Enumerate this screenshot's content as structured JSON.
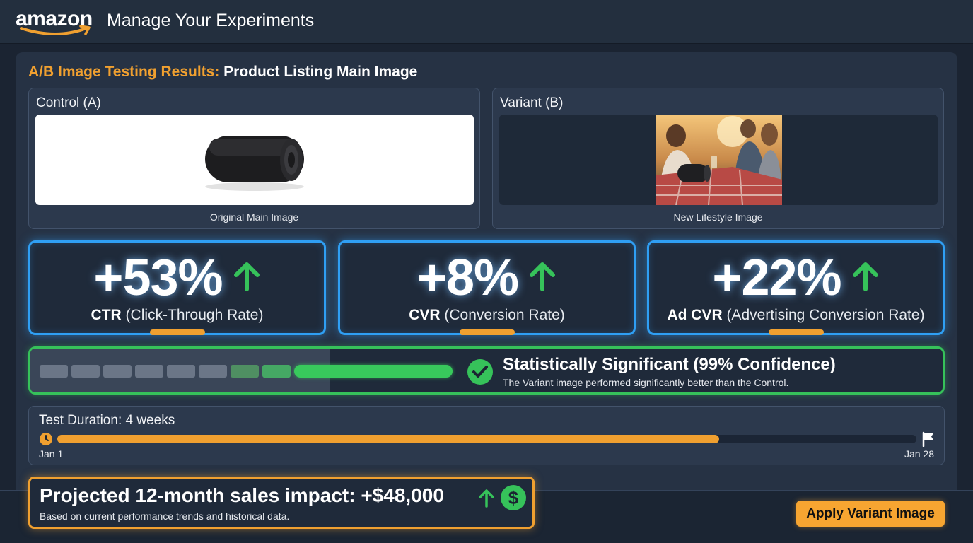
{
  "header": {
    "logo_text": "amazon",
    "app_title": "Manage Your Experiments"
  },
  "results": {
    "title_prefix": "A/B Image Testing Results:",
    "title_subject": " Product Listing Main Image"
  },
  "control": {
    "label": "Control (A)",
    "caption": "Original Main Image"
  },
  "variant": {
    "label": "Variant (B)",
    "caption": "New Lifestyle Image"
  },
  "metrics": [
    {
      "value": "+53%",
      "abbr": "CTR",
      "desc": " (Click-Through Rate)"
    },
    {
      "value": "+8%",
      "abbr": "CVR",
      "desc": " (Conversion Rate)"
    },
    {
      "value": "+22%",
      "abbr": "Ad CVR",
      "desc": " (Advertising Conversion Rate)"
    }
  ],
  "significance": {
    "title": "Statistically Significant (99% Confidence)",
    "subtitle": "The Variant image performed significantly better than the Control.",
    "confidence_percent": 99
  },
  "duration": {
    "title": "Test Duration: 4 weeks",
    "start_label": "Jan 1",
    "end_label": "Jan 28",
    "progress_fraction": 0.77
  },
  "projection": {
    "title": "Projected 12-month sales impact: +$48,000",
    "subtitle": "Based on current performance trends and historical data."
  },
  "actions": {
    "apply_label": "Apply Variant Image"
  },
  "colors": {
    "accent_orange": "#f0a030",
    "metric_blue": "#2f9ff4",
    "success_green": "#36c25a",
    "background": "#1b2432"
  },
  "icons": {
    "metric_trend": "arrow-up-icon",
    "significance": "check-circle-icon",
    "duration_start": "clock-icon",
    "duration_end": "flag-icon",
    "projection": "dollar-circle-icon"
  }
}
